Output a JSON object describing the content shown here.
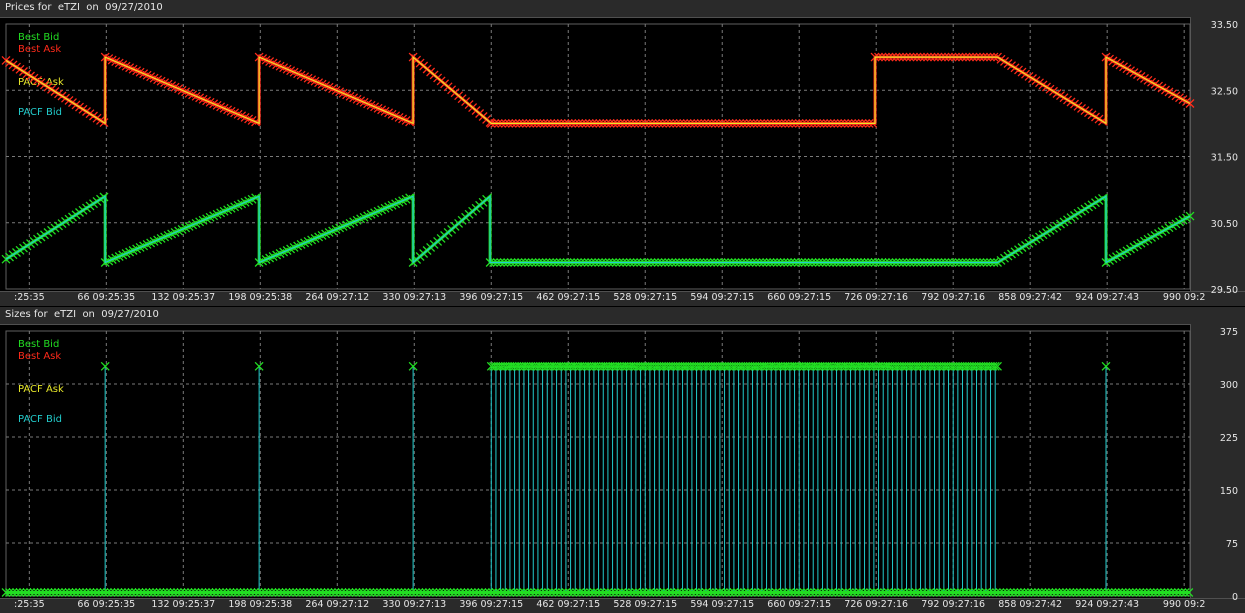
{
  "chart_data": [
    {
      "type": "line",
      "title": "Prices for  eTZI  on  09/27/2010",
      "ylim": [
        29.5,
        33.5
      ],
      "yticks": [
        "33.50",
        "32.50",
        "31.50",
        "30.50",
        "29.50"
      ],
      "ytick_values": [
        33.5,
        32.5,
        31.5,
        30.5,
        29.5
      ],
      "xlim": [
        -20,
        995
      ],
      "x_tick_labels": [
        ":25:35",
        "66 09:25:35",
        "132 09:25:37",
        "198 09:25:38",
        "264 09:27:12",
        "330 09:27:13",
        "396 09:27:15",
        "462 09:27:15",
        "528 09:27:15",
        "594 09:27:15",
        "660 09:27:15",
        "726 09:27:16",
        "792 09:27:16",
        "858 09:27:42",
        "924 09:27:43",
        "990 09:2"
      ],
      "x_tick_values": [
        0,
        66,
        132,
        198,
        264,
        330,
        396,
        462,
        528,
        594,
        660,
        726,
        792,
        858,
        924,
        990
      ],
      "grid": true,
      "legend_position": "top-left",
      "legend": [
        {
          "name": "Best Bid",
          "color": "#22dd22"
        },
        {
          "name": "Best Ask",
          "color": "#ff2a1a"
        },
        {
          "name": "PACF Ask",
          "color": "#e8e82a"
        },
        {
          "name": "PACF Bid",
          "color": "#22cccc"
        }
      ],
      "series": [
        {
          "name": "Best Ask",
          "color": "#ff2a1a",
          "x": [
            -20,
            65,
            65,
            197,
            197,
            329,
            329,
            396,
            725,
            725,
            830,
            923,
            923,
            995
          ],
          "values": [
            32.95,
            32.0,
            33.0,
            32.0,
            33.0,
            32.0,
            33.0,
            32.0,
            32.0,
            33.0,
            33.0,
            32.0,
            33.0,
            32.3
          ]
        },
        {
          "name": "Best Bid",
          "color": "#22dd22",
          "x": [
            -20,
            65,
            65,
            197,
            197,
            329,
            329,
            395,
            395,
            830,
            923,
            923,
            995
          ],
          "values": [
            29.95,
            30.9,
            29.9,
            30.9,
            29.9,
            30.9,
            29.9,
            30.9,
            29.9,
            29.9,
            30.9,
            29.9,
            30.6
          ]
        },
        {
          "name": "PACF Ask",
          "color": "#e8e82a",
          "x": [
            -20,
            65,
            65,
            197,
            197,
            329,
            329,
            396,
            725,
            725,
            830,
            923,
            923,
            995
          ],
          "values": [
            32.95,
            32.0,
            33.0,
            32.0,
            33.0,
            32.0,
            33.0,
            32.0,
            32.0,
            33.0,
            33.0,
            32.0,
            33.0,
            32.3
          ]
        },
        {
          "name": "PACF Bid",
          "color": "#22cccc",
          "x": [
            -20,
            65,
            65,
            197,
            197,
            329,
            329,
            395,
            395,
            830,
            923,
            923,
            995
          ],
          "values": [
            29.95,
            30.9,
            29.9,
            30.9,
            29.9,
            30.9,
            29.9,
            30.9,
            29.9,
            29.9,
            30.9,
            29.9,
            30.6
          ]
        }
      ]
    },
    {
      "type": "bar",
      "title": "Sizes for  eTZI  on  09/27/2010",
      "ylim": [
        0,
        375
      ],
      "yticks": [
        "375",
        "300",
        "225",
        "150",
        "75",
        "0"
      ],
      "ytick_values": [
        375,
        300,
        225,
        150,
        75,
        0
      ],
      "xlim": [
        -20,
        995
      ],
      "x_tick_labels": [
        ":25:35",
        "66 09:25:35",
        "132 09:25:37",
        "198 09:25:38",
        "264 09:27:12",
        "330 09:27:13",
        "396 09:27:15",
        "462 09:27:15",
        "528 09:27:15",
        "594 09:27:15",
        "660 09:27:15",
        "726 09:27:16",
        "792 09:27:16",
        "858 09:27:42",
        "924 09:27:43",
        "990 09:2"
      ],
      "x_tick_values": [
        0,
        66,
        132,
        198,
        264,
        330,
        396,
        462,
        528,
        594,
        660,
        726,
        792,
        858,
        924,
        990
      ],
      "grid": true,
      "legend_position": "top-left",
      "legend": [
        {
          "name": "Best Bid",
          "color": "#22dd22"
        },
        {
          "name": "Best Ask",
          "color": "#ff2a1a"
        },
        {
          "name": "PACF Ask",
          "color": "#e8e82a"
        },
        {
          "name": "PACF Bid",
          "color": "#22cccc"
        }
      ],
      "baseline_value": 5,
      "spikes": [
        {
          "x": 65,
          "value": 325
        },
        {
          "x": 197,
          "value": 325
        },
        {
          "x": 329,
          "value": 325
        },
        {
          "x": 923,
          "value": 325
        }
      ],
      "dense_block": {
        "x_start": 396,
        "x_end": 830,
        "value": 325,
        "step": 4
      }
    }
  ]
}
